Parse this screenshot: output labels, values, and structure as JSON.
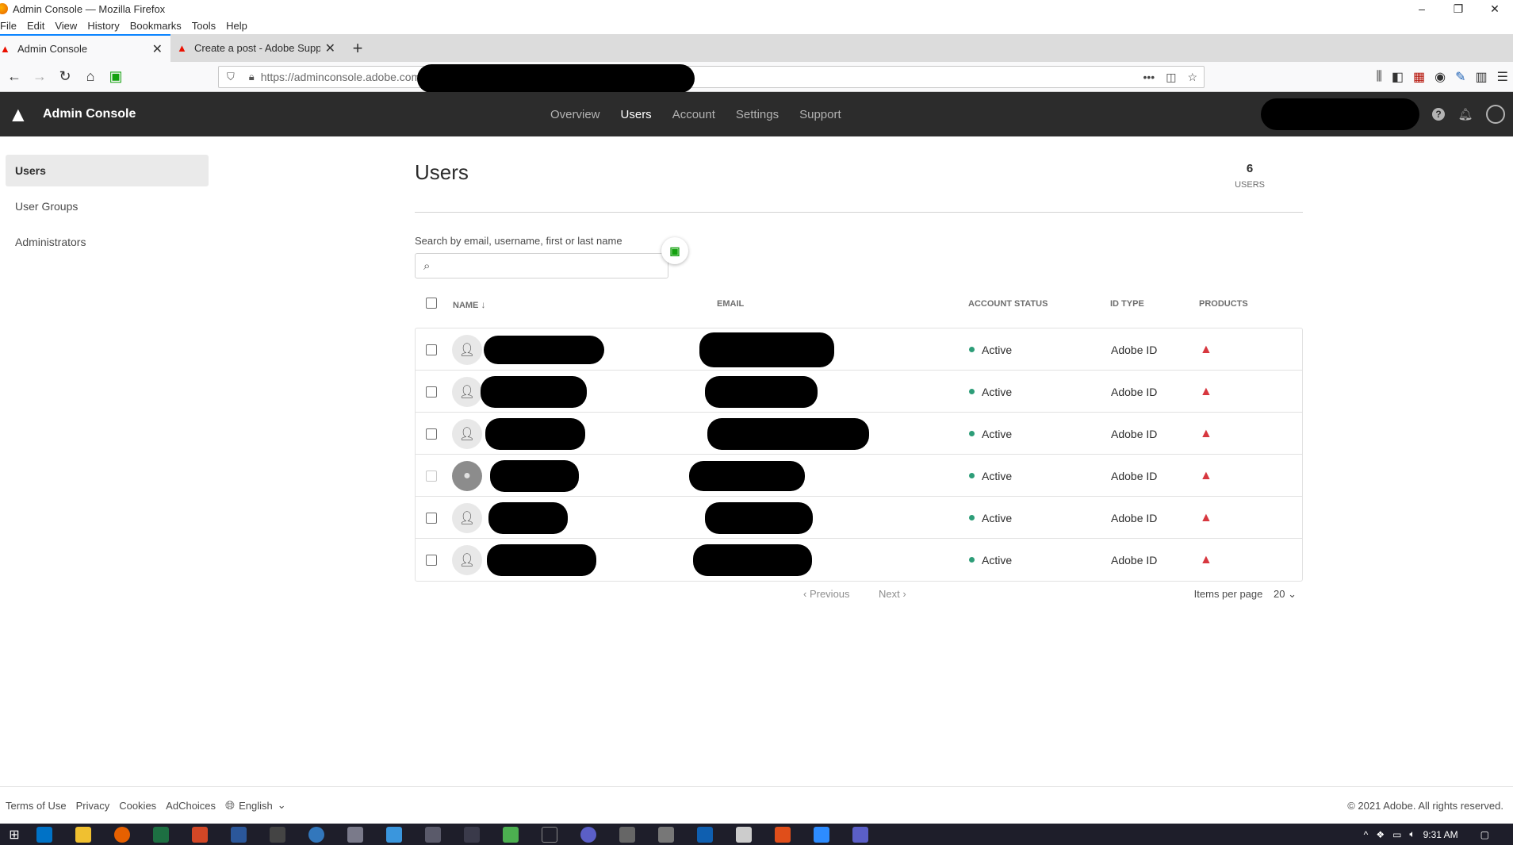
{
  "window": {
    "title": "Admin Console — Mozilla Firefox",
    "controls": [
      "–",
      "❐",
      "✕"
    ]
  },
  "menubar": [
    "File",
    "Edit",
    "View",
    "History",
    "Bookmarks",
    "Tools",
    "Help"
  ],
  "tabs": [
    {
      "title": "Admin Console",
      "active": true
    },
    {
      "title": "Create a post - Adobe Support",
      "active": false
    }
  ],
  "navbar": {
    "url": "https://adminconsole.adobe.com"
  },
  "header": {
    "app_title": "Admin Console",
    "nav": [
      "Overview",
      "Users",
      "Account",
      "Settings",
      "Support"
    ],
    "current_nav": "Users"
  },
  "sidebar": {
    "items": [
      "Users",
      "User Groups",
      "Administrators"
    ],
    "selected": "Users"
  },
  "main": {
    "title": "Users",
    "count": "6",
    "count_label": "USERS",
    "search_label": "Search by email, username, first or last name",
    "search_value": ""
  },
  "table": {
    "columns": [
      "NAME",
      "EMAIL",
      "ACCOUNT STATUS",
      "ID TYPE",
      "PRODUCTS"
    ],
    "rows": [
      {
        "status": "Active",
        "id_type": "Adobe ID"
      },
      {
        "status": "Active",
        "id_type": "Adobe ID"
      },
      {
        "status": "Active",
        "id_type": "Adobe ID"
      },
      {
        "status": "Active",
        "id_type": "Adobe ID"
      },
      {
        "status": "Active",
        "id_type": "Adobe ID"
      },
      {
        "status": "Active",
        "id_type": "Adobe ID"
      }
    ]
  },
  "pagination": {
    "previous": "Previous",
    "next": "Next",
    "items_per_page_label": "Items per page",
    "items_per_page_value": "20"
  },
  "footer": {
    "links": [
      "Terms of Use",
      "Privacy",
      "Cookies",
      "AdChoices"
    ],
    "language": "English",
    "copyright": "© 2021 Adobe. All rights reserved."
  },
  "taskbar": {
    "time": "9:31 AM"
  },
  "colors": {
    "header_bg": "#2c2c2c",
    "status_active": "#2d9d78",
    "warning": "#d7373f",
    "tab_accent": "#0a84ff"
  }
}
